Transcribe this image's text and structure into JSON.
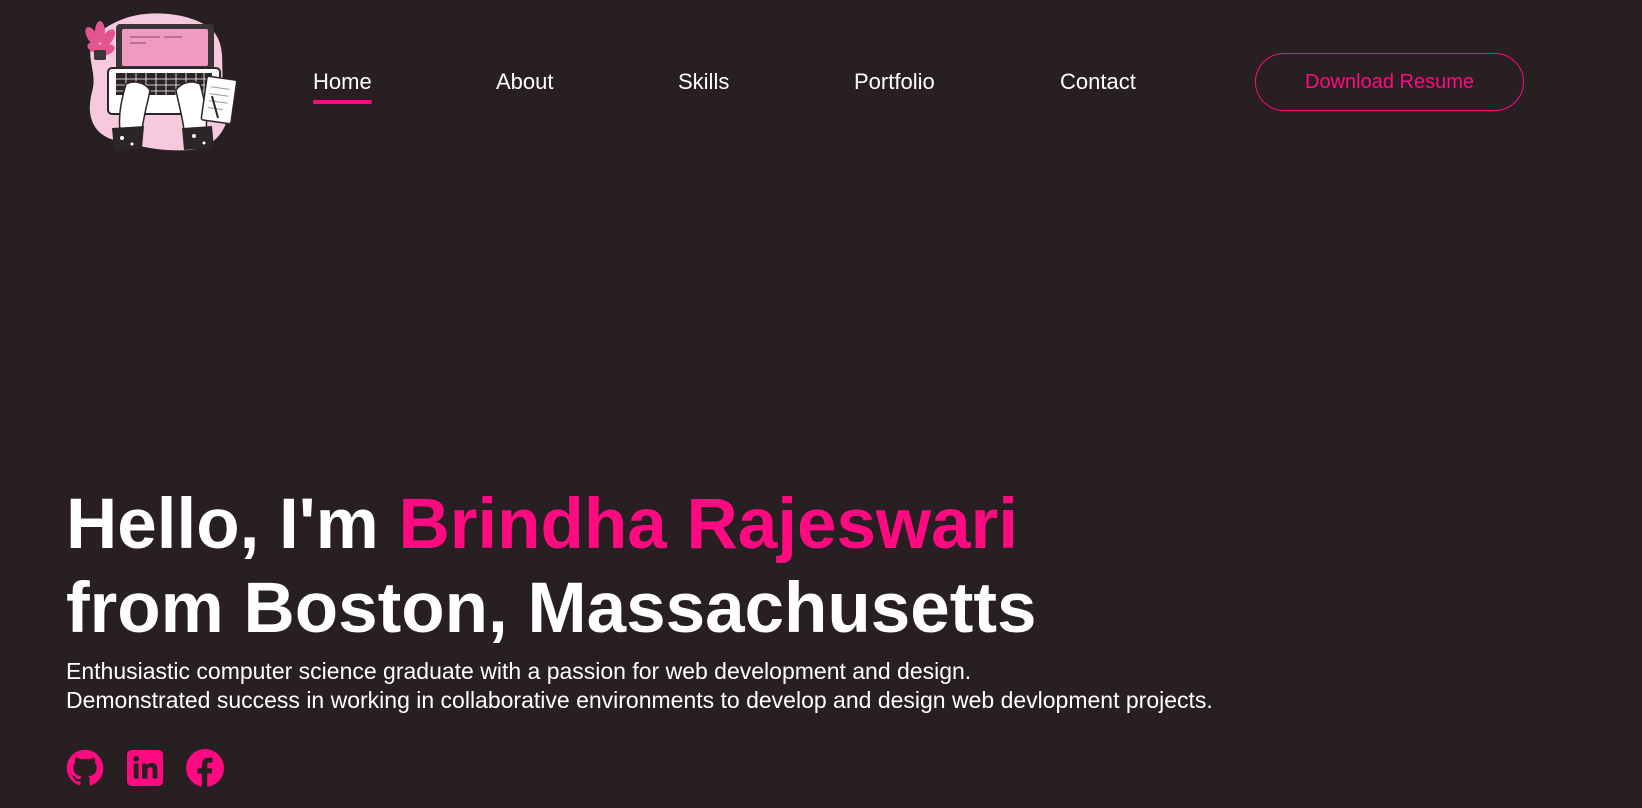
{
  "nav": {
    "items": [
      {
        "label": "Home",
        "active": true
      },
      {
        "label": "About",
        "active": false
      },
      {
        "label": "Skills",
        "active": false
      },
      {
        "label": "Portfolio",
        "active": false
      },
      {
        "label": "Contact",
        "active": false
      }
    ],
    "resume_button": "Download Resume"
  },
  "hero": {
    "greeting": "Hello, I'm ",
    "name": "Brindha Rajeswari",
    "location_line": "from Boston, Massachusetts",
    "description": [
      "Enthusiastic computer science graduate with a passion for web development and design.",
      "Demonstrated success in working in collaborative environments to develop and design web devlopment projects."
    ]
  },
  "socials": [
    {
      "icon": "github-icon"
    },
    {
      "icon": "linkedin-icon"
    },
    {
      "icon": "facebook-icon"
    }
  ],
  "colors": {
    "background": "#271f21",
    "accent": "#ff0a80",
    "text": "#ffffff"
  }
}
